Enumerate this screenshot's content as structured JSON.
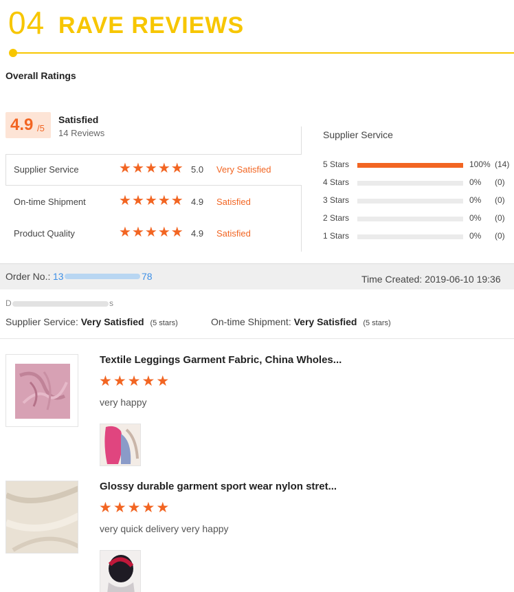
{
  "header": {
    "number": "04",
    "title": "RAVE REVIEWS",
    "accent_color": "#f7c600"
  },
  "overall": {
    "title": "Overall Ratings",
    "score": "4.9",
    "score_max": "/5",
    "label": "Satisfied",
    "reviews": "14 Reviews",
    "rows": [
      {
        "label": "Supplier Service",
        "score": "5.0",
        "text": "Very Satisfied",
        "stars": 5
      },
      {
        "label": "On-time Shipment",
        "score": "4.9",
        "text": "Satisfied",
        "stars": 5
      },
      {
        "label": "Product Quality",
        "score": "4.9",
        "text": "Satisfied",
        "stars": 5
      }
    ]
  },
  "supplier_service": {
    "title": "Supplier Service",
    "bars": [
      {
        "label": "5 Stars",
        "pct": "100%",
        "count": "(14)",
        "fill": 1.0
      },
      {
        "label": "4 Stars",
        "pct": "0%",
        "count": "(0)",
        "fill": 0
      },
      {
        "label": "3 Stars",
        "pct": "0%",
        "count": "(0)",
        "fill": 0
      },
      {
        "label": "2 Stars",
        "pct": "0%",
        "count": "(0)",
        "fill": 0
      },
      {
        "label": "1 Stars",
        "pct": "0%",
        "count": "(0)",
        "fill": 0
      }
    ]
  },
  "order": {
    "label": "Order No.:",
    "num_start": "13",
    "num_end": "78",
    "time_created": "Time Created: 2019-06-10 19:36"
  },
  "buyer": {
    "start": "D",
    "end": "s"
  },
  "feedback": {
    "supplier_label": "Supplier Service:",
    "supplier_value": "Very Satisfied",
    "supplier_stars": "(5 stars)",
    "shipment_label": "On-time Shipment:",
    "shipment_value": "Very Satisfied",
    "shipment_stars": "(5 stars)"
  },
  "products": [
    {
      "title": "Textile Leggings Garment Fabric, China Wholes...",
      "comment": "very happy",
      "stars": 5
    },
    {
      "title": "Glossy durable garment sport wear nylon stret...",
      "comment": "very quick delivery very happy",
      "stars": 5
    }
  ],
  "star_glyph": "★",
  "star_color": "#f26522"
}
